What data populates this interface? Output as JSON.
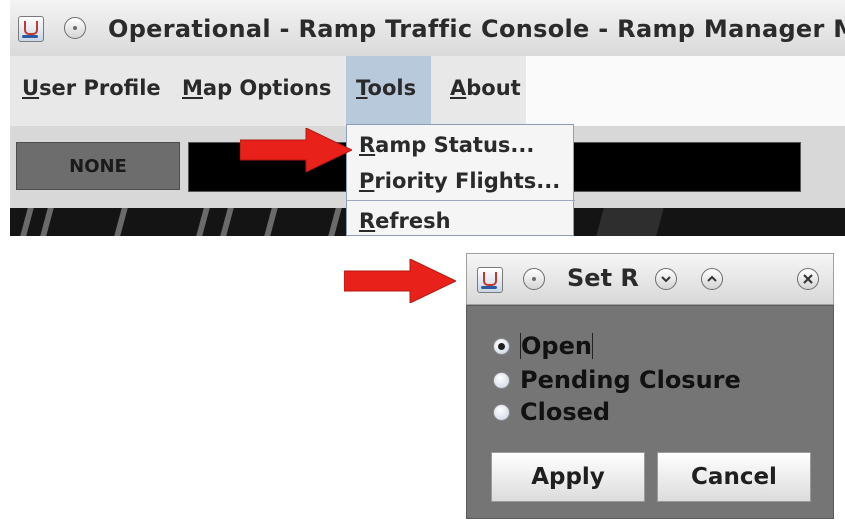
{
  "main_window": {
    "title": "Operational - Ramp Traffic Console - Ramp Manager Mo",
    "menu": {
      "items": [
        {
          "mnemonic": "U",
          "rest": "ser Profile"
        },
        {
          "mnemonic": "M",
          "rest": "ap Options"
        },
        {
          "mnemonic": "T",
          "rest": "ools"
        },
        {
          "mnemonic": "A",
          "rest": "bout"
        }
      ]
    },
    "toolbar": {
      "status_label": "NONE"
    },
    "tools_menu": {
      "items": [
        {
          "mnemonic": "R",
          "rest": "amp Status..."
        },
        {
          "mnemonic": "P",
          "rest": "riority Flights..."
        },
        {
          "mnemonic": "R",
          "rest": "efresh"
        }
      ]
    }
  },
  "dialog": {
    "title": "Set R",
    "options": [
      {
        "label": "Open",
        "selected": true
      },
      {
        "label": "Pending Closure",
        "selected": false
      },
      {
        "label": "Closed",
        "selected": false
      }
    ],
    "apply_label": "Apply",
    "cancel_label": "Cancel"
  },
  "colors": {
    "arrow": "#e8221b",
    "menu_highlight": "#b9c9dc",
    "dialog_body": "#757575"
  },
  "icons": [
    "java-app-icon",
    "window-menu-icon",
    "minimize-icon",
    "maximize-icon",
    "close-icon",
    "red-arrow-icon"
  ]
}
